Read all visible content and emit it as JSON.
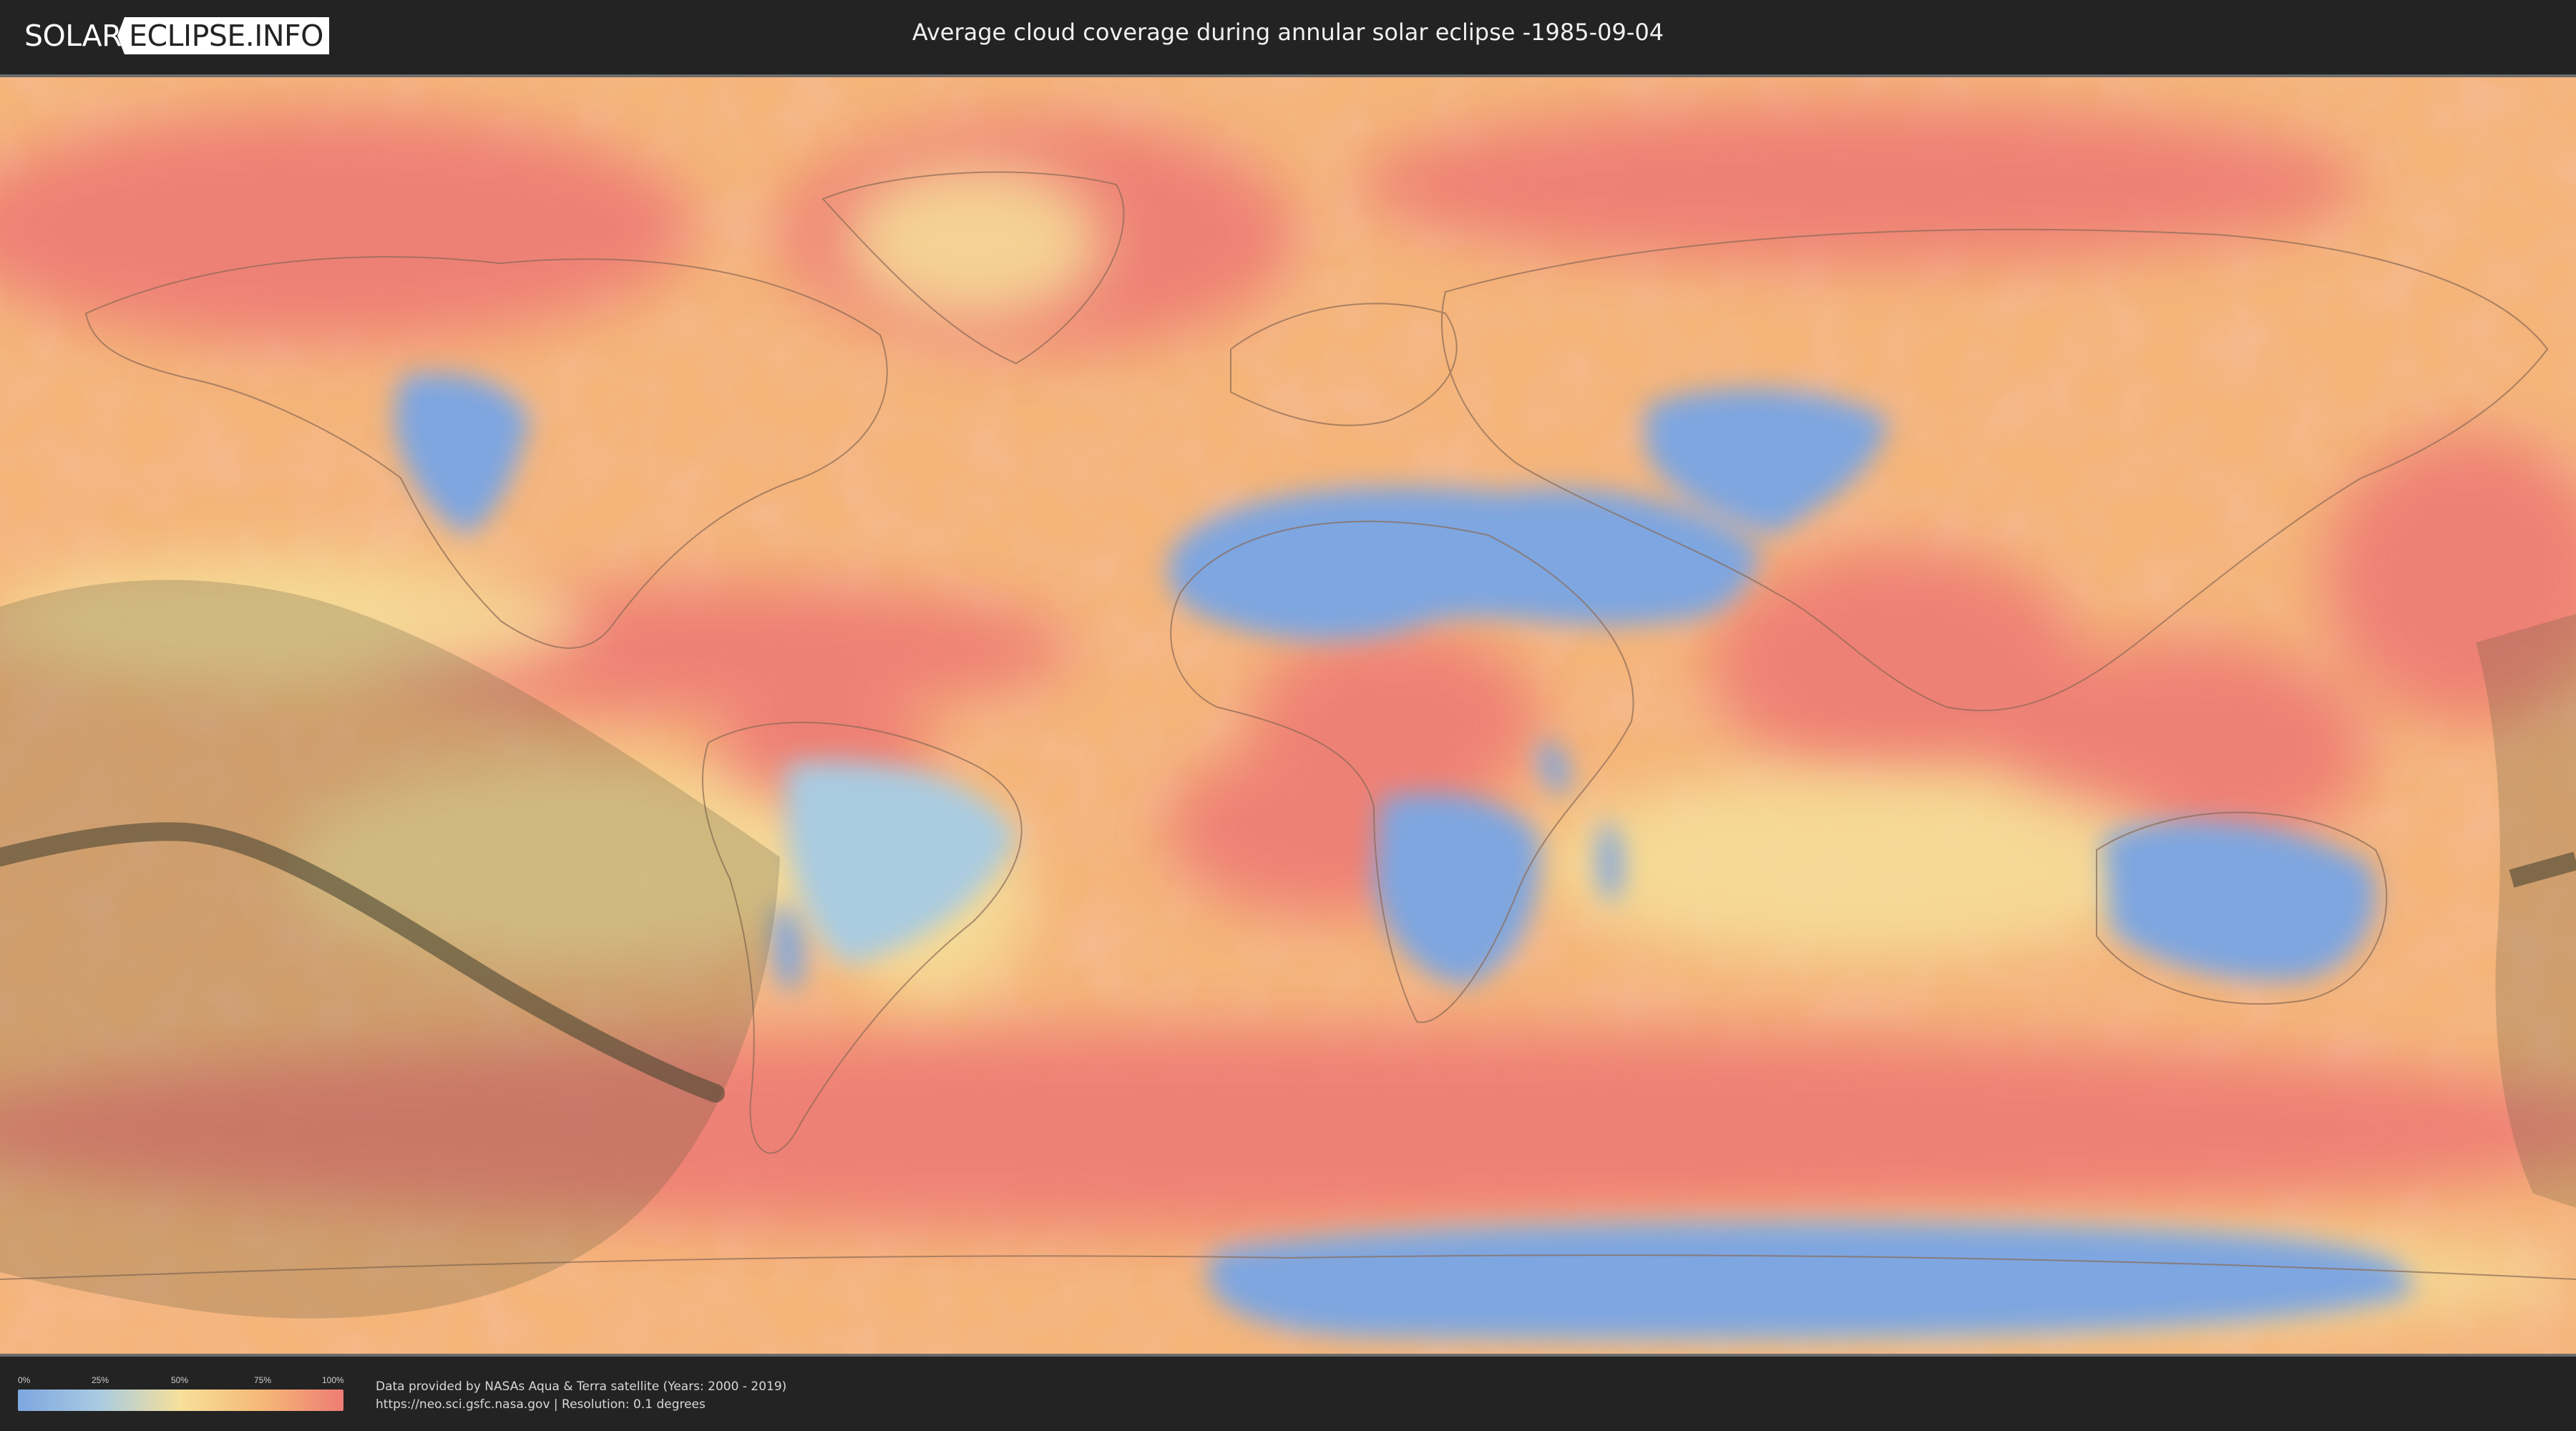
{
  "header": {
    "logo_part1": "SOLAR",
    "logo_part2": "ECLIPSE.INFO",
    "title": "Average cloud coverage during annular solar eclipse -1985-09-04"
  },
  "legend": {
    "ticks": [
      "0%",
      "25%",
      "50%",
      "75%",
      "100%"
    ],
    "colors": [
      "#7ea6e0",
      "#a9cbe1",
      "#f6e09a",
      "#f5b877",
      "#ee7c74"
    ]
  },
  "footer": {
    "credit_line1": "Data provided by NASAs Aqua & Terra satellite (Years: 2000 - 2019)",
    "credit_line2": "https://neo.sci.gsfc.nasa.gov | Resolution: 0.1 degrees"
  },
  "map": {
    "palette": {
      "clear": "#7ea6e0",
      "low": "#a9cbe1",
      "mid": "#f6e09a",
      "high": "#f5b877",
      "overcast": "#ee7c74",
      "coast_line": "#8a6a55",
      "eclipse_shadow": "#5f5a3f",
      "central_path": "#4b4632"
    }
  }
}
